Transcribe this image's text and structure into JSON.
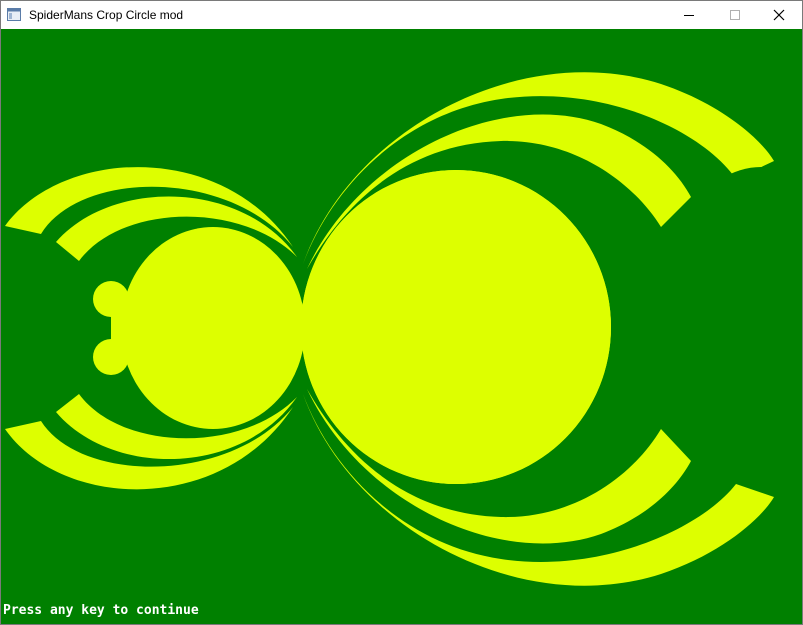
{
  "window": {
    "title": "SpiderMans Crop Circle mod"
  },
  "title_controls": {
    "minimize_icon": "minimize-icon",
    "maximize_icon": "maximize-icon",
    "close_icon": "close-icon"
  },
  "canvas": {
    "background_color": "#008000",
    "shape_color": "#DDFF00",
    "prompt": "Press any key to continue"
  }
}
